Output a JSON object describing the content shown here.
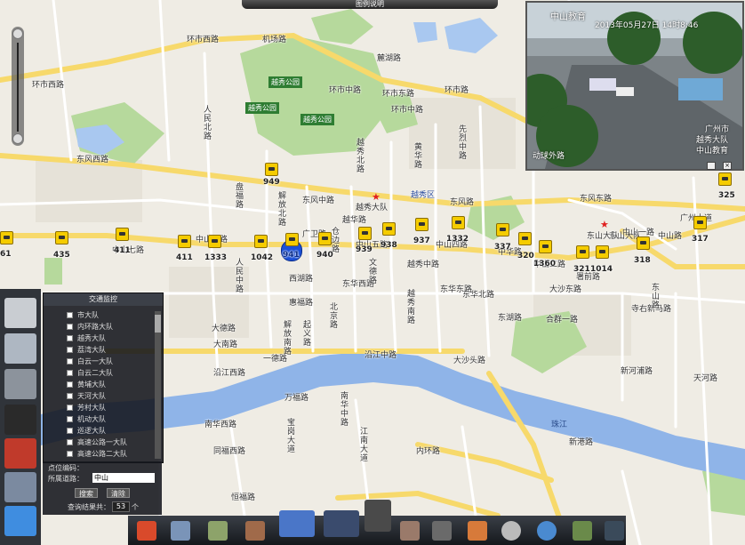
{
  "window": {
    "title_bar_label": "图例说明"
  },
  "map": {
    "parks": [
      "越秀公园",
      "越秀公园",
      "越秀公园"
    ],
    "roads": [
      "环市西路",
      "环市西路",
      "环市东路",
      "环市中路",
      "机场路",
      "环市路",
      "人民北路",
      "解放北路",
      "东风中路",
      "东风西路",
      "东风东路",
      "东风路",
      "中山六路",
      "中山七路",
      "中山四路",
      "中山五路",
      "中山路",
      "中山一路",
      "中山二路",
      "东华北路",
      "东华东路",
      "东华西路",
      "沿江中路",
      "沿江西路",
      "大沙头路",
      "东湖路",
      "大沙东路",
      "大德路",
      "人民中路",
      "北京路",
      "越华路",
      "盘福路",
      "广卫路",
      "西湖路",
      "惠福路",
      "一德路",
      "起义路",
      "解放南路",
      "寺右新马路",
      "广州大道",
      "先烈中路",
      "黄华路",
      "内环路",
      "江南大道",
      "宝岗大道",
      "新港路",
      "南华西路",
      "南华中路",
      "同福西路",
      "万福路",
      "天河路",
      "东山大队",
      "恒福路",
      "文德路",
      "大南路",
      "仓边路",
      "越秀北路",
      "越秀中路",
      "越秀南路",
      "环市中路",
      "署前路",
      "合群一路",
      "东山路",
      "新河浦路",
      "中华路",
      "麓湖路"
    ],
    "river_label": "珠江",
    "district_label": "越秀区",
    "cameras": [
      {
        "id": "cam-949",
        "label": "949"
      },
      {
        "id": "cam-435",
        "label": "435"
      },
      {
        "id": "cam-411a",
        "label": "411"
      },
      {
        "id": "cam-411b",
        "label": "411"
      },
      {
        "id": "cam-1333",
        "label": "1333"
      },
      {
        "id": "cam-1042",
        "label": "1042"
      },
      {
        "id": "cam-941",
        "label": "941"
      },
      {
        "id": "cam-940",
        "label": "940"
      },
      {
        "id": "cam-939",
        "label": "939"
      },
      {
        "id": "cam-938",
        "label": "938"
      },
      {
        "id": "cam-937",
        "label": "937"
      },
      {
        "id": "cam-1332",
        "label": "1332"
      },
      {
        "id": "cam-337",
        "label": "337"
      },
      {
        "id": "cam-320",
        "label": "320"
      },
      {
        "id": "cam-1360",
        "label": "1360"
      },
      {
        "id": "cam-321",
        "label": "321"
      },
      {
        "id": "cam-1014",
        "label": "1014"
      },
      {
        "id": "cam-318",
        "label": "318"
      },
      {
        "id": "cam-317",
        "label": "317"
      },
      {
        "id": "cam-325",
        "label": "325"
      },
      {
        "id": "cam-61",
        "label": "61"
      }
    ],
    "brigade_labels": [
      "越秀大队",
      "东山大队"
    ]
  },
  "video": {
    "title": "中山教育",
    "datetime": "2013年05月27日 14时8:46",
    "overlay_right_1": "广州市",
    "overlay_right_2": "越秀大队",
    "overlay_right_3": "中山教育",
    "overlay_left": "动球外路"
  },
  "panel": {
    "title": "交通监控",
    "items": [
      "市大队",
      "内环路大队",
      "越秀大队",
      "荔湾大队",
      "白云一大队",
      "白云二大队",
      "黄埔大队",
      "天河大队",
      "芳村大队",
      "机动大队",
      "巡逻大队",
      "高速公路一大队",
      "高速公路二大队"
    ],
    "code_label": "点位编码：",
    "road_label": "所属道路：",
    "road_value": "中山",
    "search_button": "搜索",
    "clear_button": "清除",
    "result_label": "查询结果共：",
    "result_value": "53",
    "result_unit": "个"
  },
  "colors": {
    "accent": "#f5cc00",
    "selected": "#1a4fd6",
    "panel_bg": "#14161c"
  }
}
